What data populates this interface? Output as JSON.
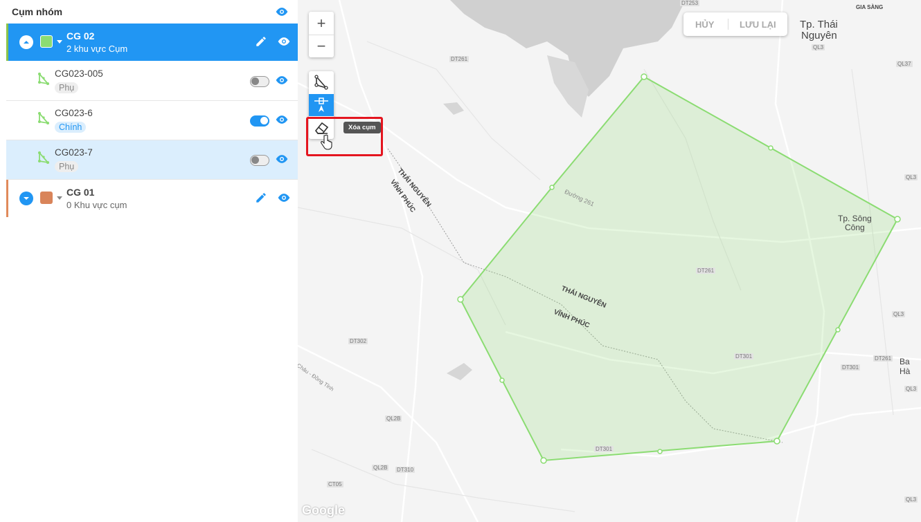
{
  "panel": {
    "title": "Cụm nhóm",
    "groups": [
      {
        "name": "CG 02",
        "subtitle": "2 khu vực Cụm",
        "color": "#8bdc72",
        "expanded": true,
        "state": "active"
      },
      {
        "name": "CG 01",
        "subtitle": "0 Khu vực cụm",
        "color": "#d9845a",
        "expanded": false,
        "state": "inactive"
      }
    ],
    "items": [
      {
        "name": "CG023-005",
        "badge": "Phụ",
        "toggle_on": false,
        "selected": false
      },
      {
        "name": "CG023-6",
        "badge": "Chính",
        "toggle_on": true,
        "selected": false
      },
      {
        "name": "CG023-7",
        "badge": "Phụ",
        "toggle_on": false,
        "selected": true
      }
    ]
  },
  "map": {
    "zoom_in": "+",
    "zoom_out": "−",
    "tooltip": "Xóa cụm",
    "cancel_label": "HỦY",
    "save_label": "LƯU LẠI",
    "polygon_color": "#8bdc72",
    "labels": {
      "city_thai_nguyen_1": "Tp. Thái",
      "city_thai_nguyen_2": "Nguyên",
      "city_song_cong_1": "Tp. Sông",
      "city_song_cong_2": "Công",
      "province_thai_nguyen": "THÁI NGUYÊN",
      "province_vinh_phuc": "VĨNH PHÚC",
      "duong_261": "Đường 261",
      "gia_sang": "GIA SÀNG",
      "ba_ha": "Ba Hà",
      "chau_dong_tinh": "Châu - Đồng Tỉnh"
    },
    "roads": [
      "DT261",
      "DT261",
      "DT301",
      "DT301",
      "DT301",
      "DT302",
      "QL2B",
      "QL2B",
      "DT310",
      "CT05",
      "QL3",
      "QL37",
      "QL3",
      "DT261",
      "DT253",
      "QL3",
      "QL3",
      "QL3"
    ],
    "attribution": "Google"
  }
}
